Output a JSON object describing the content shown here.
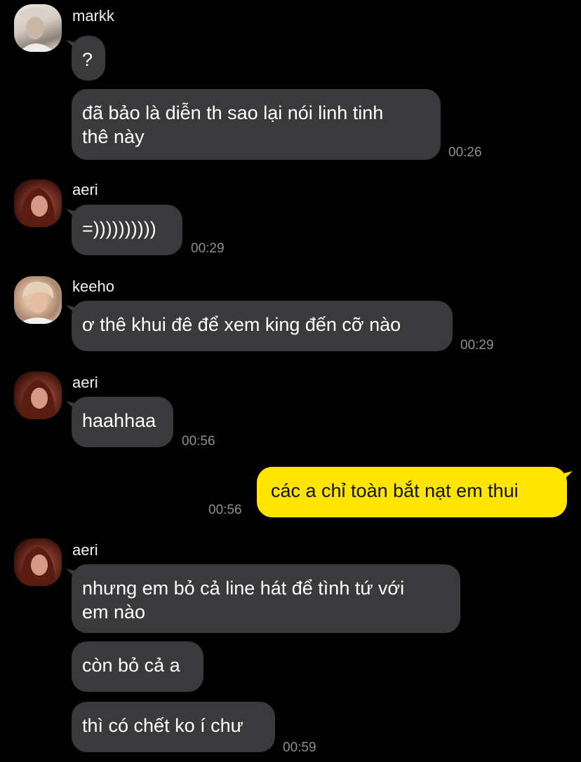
{
  "chat": {
    "messages": [
      {
        "sender": "markk",
        "lines": [
          "?"
        ]
      },
      {
        "sender": "markk",
        "lines": [
          "đã bảo là diễn th sao lại nói linh tinh",
          "thê này"
        ],
        "time": "00:26"
      },
      {
        "sender": "aeri",
        "lines": [
          "=))))))))))"
        ],
        "time": "00:29"
      },
      {
        "sender": "keeho",
        "lines": [
          "ơ thê khui đê để xem king đến cỡ nào"
        ],
        "time": "00:29"
      },
      {
        "sender": "aeri",
        "lines": [
          "haahhaa"
        ],
        "time": "00:56"
      },
      {
        "sender": "me",
        "lines": [
          "các a chỉ toàn bắt nạt em thui"
        ],
        "time": "00:56"
      },
      {
        "sender": "aeri",
        "lines": [
          "nhưng em bỏ cả line hát để tình tứ với",
          "em nào"
        ]
      },
      {
        "sender": "aeri",
        "lines": [
          "còn bỏ cả a"
        ]
      },
      {
        "sender": "aeri",
        "lines": [
          "thì có chết ko í chư"
        ],
        "time": "00:59"
      }
    ]
  },
  "colors": {
    "background": "#000000",
    "bubble_other": "#3a3a3c",
    "bubble_mine": "#fee500",
    "timestamp": "#8e8e93"
  },
  "icons": {
    "markk": "avatar-markk-photo",
    "aeri": "avatar-aeri-photo",
    "keeho": "avatar-keeho-photo"
  }
}
